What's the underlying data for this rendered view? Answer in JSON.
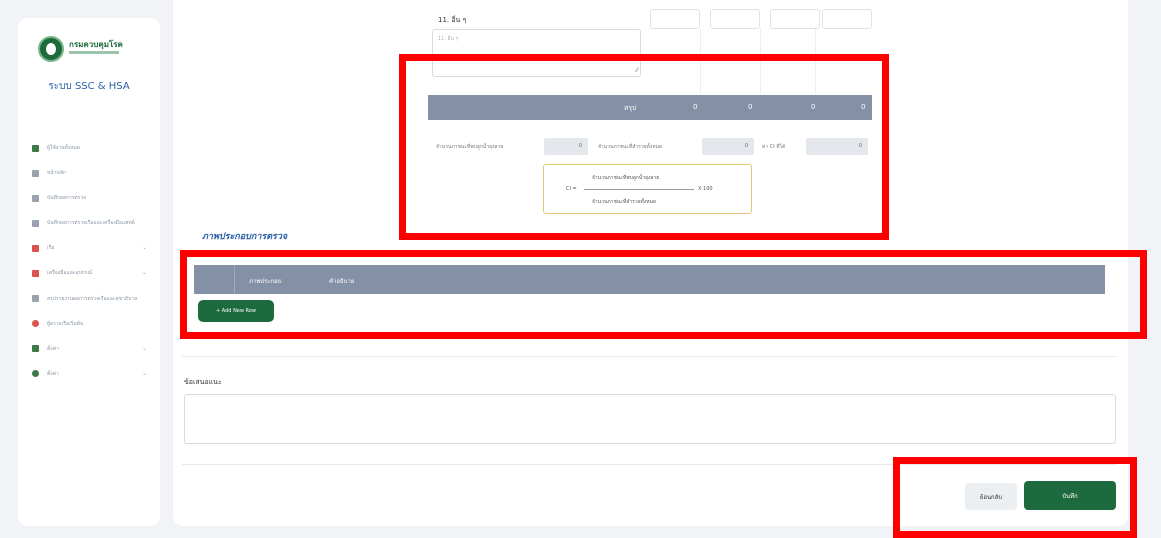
{
  "sidebar": {
    "logo_text": "กรมควบคุมโรค",
    "system_title": "ระบบ SSC & HSA",
    "items": [
      {
        "label": "ผู้ใช้งานทั้งหมด",
        "icon": "user-icon",
        "color": "#3f7a45",
        "chevron": false
      },
      {
        "label": "หน้าหลัก",
        "icon": "home-icon",
        "color": "#9aa3ad",
        "chevron": false
      },
      {
        "label": "บันทึกผลการตรวจ",
        "icon": "chart-icon",
        "color": "#9aa3ad",
        "chevron": false
      },
      {
        "label": "บันทึกผลการตรวจเรือและเครื่องมือแพทย์",
        "icon": "chart-icon",
        "color": "#9aa3ad",
        "chevron": false
      },
      {
        "label": "เรือ",
        "icon": "ship-icon",
        "color": "#d9534f",
        "chevron": true
      },
      {
        "label": "เครื่องมือและอุปกรณ์",
        "icon": "tool-icon",
        "color": "#d9534f",
        "chevron": true
      },
      {
        "label": "สรุปรายงานผลการตรวจเรือและสุขาภิบาล",
        "icon": "report-icon",
        "color": "#9aa3ad",
        "chevron": false
      },
      {
        "label": "ผู้ตรวจเรือเริ่มต้น",
        "icon": "person-icon",
        "color": "#d9534f",
        "chevron": false
      },
      {
        "label": "ตั้งค่า",
        "icon": "grid-icon",
        "color": "#3f7a45",
        "chevron": true
      },
      {
        "label": "ตั้งค่า",
        "icon": "gear-icon",
        "color": "#3f7a45",
        "chevron": true
      }
    ]
  },
  "form": {
    "field11_label": "11. อื่น ๆ",
    "field11_placeholder": "11. อื่น ๆ",
    "summary_label": "สรุป",
    "summary_values": [
      "0",
      "0",
      "0",
      "0"
    ],
    "calc_fields": [
      {
        "label": "จำนวนภาชนะที่พบลูกน้ำยุงลาย",
        "value": "0"
      },
      {
        "label": "จำนวนภาชนะที่สำรวจทั้งหมด",
        "value": "0"
      },
      {
        "label": "ค่า CI ที่ได้",
        "value": "0"
      }
    ],
    "formula": {
      "numerator": "จำนวนภาชนะที่พบลูกน้ำยุงลาย",
      "ci_label": "CI =",
      "multiplier": "X 100",
      "denominator": "จำนวนภาชนะที่สำรวจทั้งหมด"
    }
  },
  "images_section": {
    "title": "ภาพประกอบการตรวจ",
    "columns": [
      "ภาพประกอบ",
      "คำอธิบาย"
    ],
    "add_button": "+ Add New Row"
  },
  "suggestion": {
    "label": "ข้อเสนอแนะ"
  },
  "actions": {
    "back_label": "ย้อนกลับ",
    "save_label": "บันทึก"
  },
  "colors": {
    "highlight": "#ff0000",
    "primary_green": "#1e6a3f",
    "header_gray": "#8390a6"
  }
}
